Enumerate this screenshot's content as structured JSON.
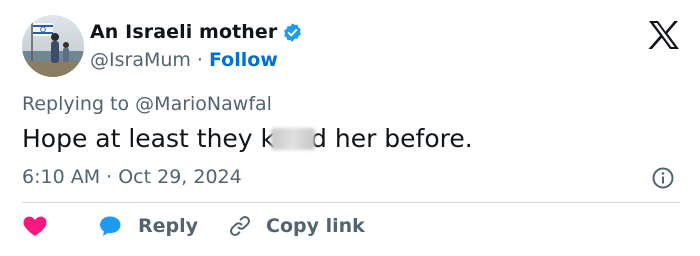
{
  "author": {
    "name": "An Israeli mother",
    "handle": "@IsraMum",
    "separator": "·",
    "follow_label": "Follow"
  },
  "reply_context": {
    "prefix": "Replying to",
    "mention": "@MarioNawfal"
  },
  "tweet": {
    "text_before": "Hope at least they k",
    "text_after": "d her before."
  },
  "timestamp": "6:10 AM · Oct 29, 2024",
  "actions": {
    "reply_label": "Reply",
    "copy_link_label": "Copy link"
  },
  "icons": {
    "verified": "verified-badge-icon",
    "logo": "x-logo-icon",
    "info": "info-icon",
    "like": "heart-icon",
    "reply": "chat-bubble-icon",
    "link": "link-icon"
  },
  "colors": {
    "link": "#006fd6",
    "verified": "#1d9bf0",
    "heart": "#f91880",
    "muted": "#536471"
  }
}
